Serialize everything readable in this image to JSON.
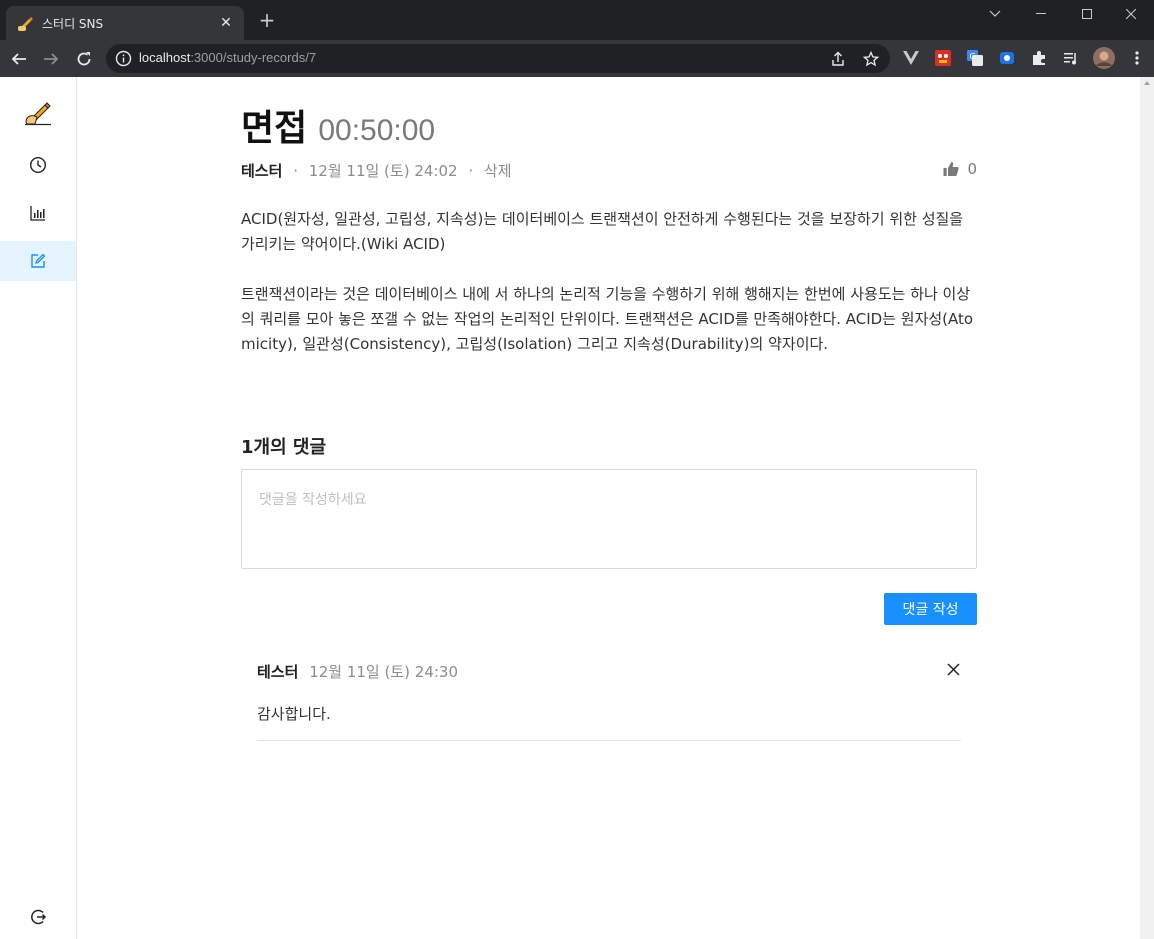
{
  "browser": {
    "tab_title": "스터디 SNS",
    "tab_close": "✕",
    "new_tab": "+",
    "url_host": "localhost",
    "url_rest": ":3000/study-records/7"
  },
  "post": {
    "title": "면접",
    "duration": "00:50:00",
    "author": "테스터",
    "separator": "·",
    "date": "12월 11일 (토) 24:02",
    "delete_label": "삭제",
    "like_count": "0",
    "paragraphs": [
      "ACID(원자성, 일관성, 고립성, 지속성)는 데이터베이스 트랜잭션이 안전하게 수행된다는 것을 보장하기 위한 성질을 가리키는 약어이다.(Wiki ACID)",
      "트랜잭션이라는 것은 데이터베이스 내에 서 하나의 논리적 기능을 수행하기 위해 행해지는 한번에 사용도는 하나 이상의 쿼리를 모아 놓은 쪼갤 수 없는 작업의 논리적인 단위이다. 트랜잭션은 ACID를 만족해야한다. ACID는 원자성(Atomicity), 일관성(Consistency), 고립성(Isolation) 그리고 지속성(Durability)의 약자이다."
    ]
  },
  "comments": {
    "heading": "1개의 댓글",
    "placeholder": "댓글을 작성하세요",
    "submit_label": "댓글 작성",
    "items": [
      {
        "author": "테스터",
        "date": "12월 11일 (토) 24:30",
        "text": "감사합니다."
      }
    ]
  },
  "colors": {
    "accent": "#1890ff",
    "active_bg": "#e6f4ff"
  }
}
